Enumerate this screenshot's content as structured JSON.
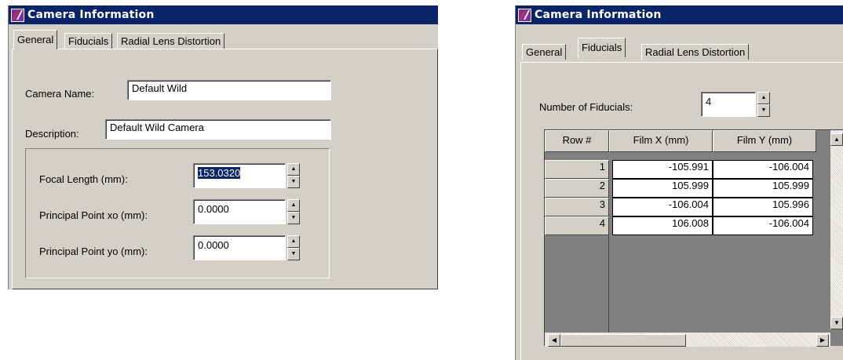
{
  "left_window": {
    "title": "Camera Information",
    "tabs": [
      "General",
      "Fiducials",
      "Radial Lens Distortion"
    ],
    "active_tab": "General",
    "camera_name": {
      "label": "Camera Name:",
      "value": "Default Wild"
    },
    "description": {
      "label": "Description:",
      "value": "Default Wild Camera"
    },
    "focal_length": {
      "label": "Focal Length (mm):",
      "value": "153.0320"
    },
    "principal_xo": {
      "label": "Principal Point xo (mm):",
      "value": "0.0000"
    },
    "principal_yo": {
      "label": "Principal Point yo (mm):",
      "value": "0.0000"
    }
  },
  "right_window": {
    "title": "Camera Information",
    "tabs": [
      "General",
      "Fiducials",
      "Radial Lens Distortion"
    ],
    "active_tab": "Fiducials",
    "num_fiducials": {
      "label": "Number of Fiducials:",
      "value": "4"
    },
    "grid": {
      "headers": [
        "Row #",
        "Film X (mm)",
        "Film Y (mm)"
      ],
      "rows": [
        {
          "row": "1",
          "x": "-105.991",
          "y": "-106.004"
        },
        {
          "row": "2",
          "x": "105.999",
          "y": "105.999"
        },
        {
          "row": "3",
          "x": "-106.004",
          "y": "105.996"
        },
        {
          "row": "4",
          "x": "106.008",
          "y": "-106.004"
        }
      ]
    }
  },
  "icons": {
    "app": "camera-app-icon",
    "spin_up": "spin-up-arrow-icon",
    "spin_down": "spin-down-arrow-icon",
    "scroll_up": "scroll-up-arrow-icon",
    "scroll_down": "scroll-down-arrow-icon",
    "scroll_left": "scroll-left-arrow-icon",
    "scroll_right": "scroll-right-arrow-icon"
  },
  "colors": {
    "titlebar": "#0a246a",
    "face": "#d4d0c8",
    "grid_bg": "#808080",
    "selection": "#0a246a"
  }
}
